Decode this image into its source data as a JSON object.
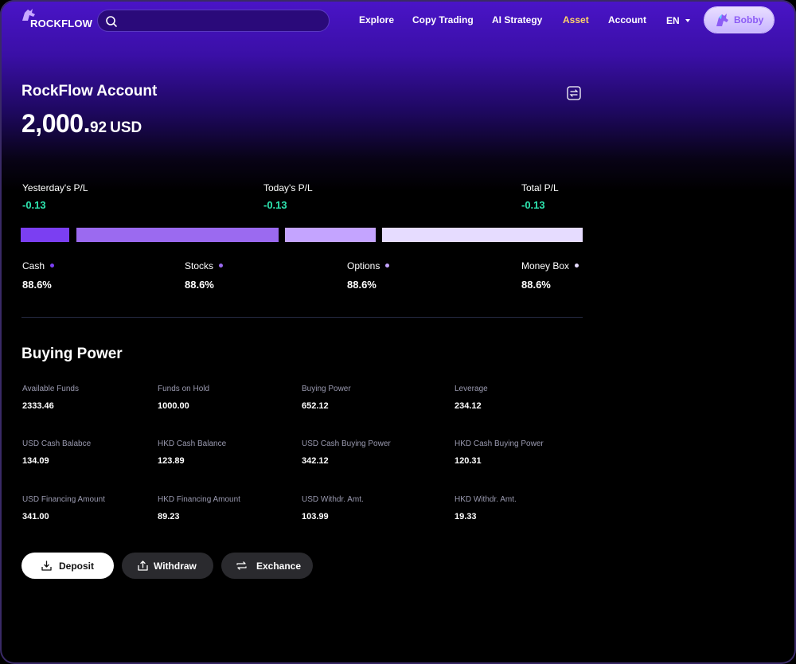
{
  "nav": {
    "logo_text": "ROCKFLOW",
    "search_placeholder": "",
    "items": [
      "Explore",
      "Copy Trading",
      "AI Strategy",
      "Asset",
      "Account"
    ],
    "active": "Asset",
    "language": "EN",
    "user_name": "Bobby"
  },
  "account": {
    "title": "RockFlow Account",
    "balance_int": "2,000.",
    "balance_dec": "92",
    "currency": "USD"
  },
  "pl": [
    {
      "label": "Yesterday's P/L",
      "value": "-0.13"
    },
    {
      "label": "Today's P/L",
      "value": "-0.13"
    },
    {
      "label": "Total P/L",
      "value": "-0.13"
    }
  ],
  "allocation": [
    {
      "label": "Cash",
      "value": "88.6%",
      "color": "#7b3ff2"
    },
    {
      "label": "Stocks",
      "value": "88.6%",
      "color": "#9b6af0"
    },
    {
      "label": "Options",
      "value": "88.6%",
      "color": "#c4a4ff"
    },
    {
      "label": "Money Box",
      "value": "88.6%",
      "color": "#e6dcff"
    }
  ],
  "buying_power": {
    "title": "Buying Power",
    "rows": [
      [
        {
          "label": "Available Funds",
          "value": "2333.46"
        },
        {
          "label": "Funds on Hold",
          "value": "1000.00"
        },
        {
          "label": "Buying Power",
          "value": "652.12"
        },
        {
          "label": "Leverage",
          "value": "234.12"
        }
      ],
      [
        {
          "label": "USD Cash Balabce",
          "value": "134.09"
        },
        {
          "label": "HKD Cash Balance",
          "value": "123.89"
        },
        {
          "label": "USD Cash Buying Power",
          "value": "342.12"
        },
        {
          "label": "HKD Cash Buying Power",
          "value": "120.31"
        }
      ],
      [
        {
          "label": "USD Financing Amount",
          "value": "341.00"
        },
        {
          "label": "HKD Financing Amount",
          "value": "89.23"
        },
        {
          "label": "USD Withdr. Amt.",
          "value": "103.99"
        },
        {
          "label": "HKD Withdr. Amt.",
          "value": "19.33"
        }
      ]
    ]
  },
  "actions": {
    "deposit": "Deposit",
    "withdraw": "Withdraw",
    "exchange": "Exchance"
  },
  "colors": {
    "positive": "#2ee6b0",
    "accent": "#ffd36b",
    "brand": "#4a14c8"
  }
}
